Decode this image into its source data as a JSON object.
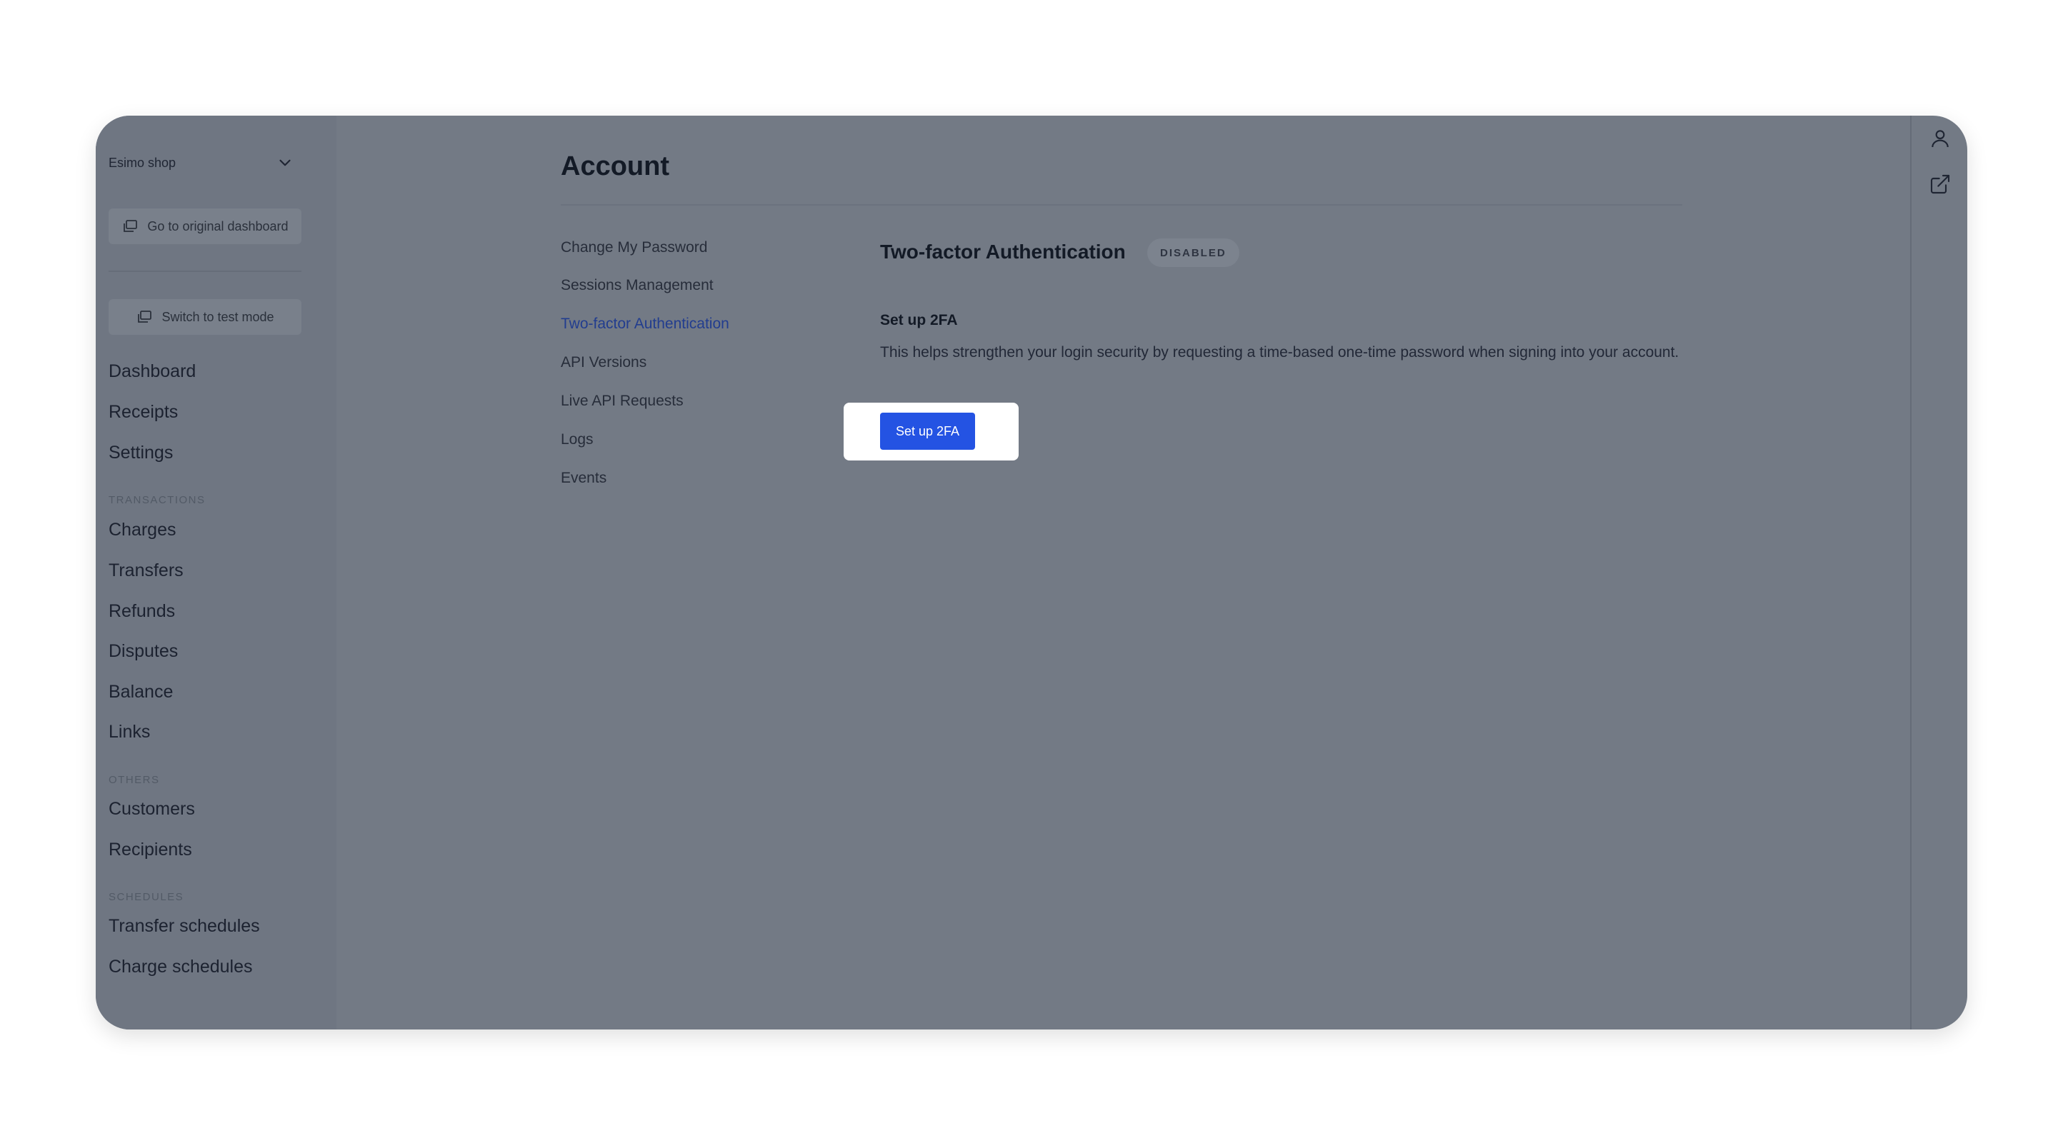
{
  "sidebar": {
    "shop_name": "Esimo shop",
    "go_original_label": "Go to original dashboard",
    "test_mode_label": "Switch to test mode",
    "main_items": [
      "Dashboard",
      "Receipts",
      "Settings"
    ],
    "transactions_label": "TRANSACTIONS",
    "transactions_items": [
      "Charges",
      "Transfers",
      "Refunds",
      "Disputes",
      "Balance",
      "Links"
    ],
    "others_label": "OTHERS",
    "others_items": [
      "Customers",
      "Recipients"
    ],
    "schedules_label": "SCHEDULES",
    "schedules_items": [
      "Transfer schedules",
      "Charge schedules"
    ]
  },
  "main": {
    "title": "Account",
    "subnav": [
      "Change My Password",
      "Sessions Management",
      "Two-factor Authentication",
      "API Versions",
      "Live API Requests",
      "Logs",
      "Events"
    ],
    "active_subnav": "Two-factor Authentication",
    "section_title": "Two-factor Authentication",
    "status_badge": "DISABLED",
    "setup_heading": "Set up 2FA",
    "setup_description": "This helps strengthen your login security by requesting a time-based one-time password when signing into your account.",
    "setup_button": "Set up 2FA"
  },
  "icons": {
    "shop_dropdown": "chevron-down-icon",
    "go_original": "window-stack-icon",
    "test_mode": "window-stack-icon",
    "profile": "user-icon",
    "external": "external-link-icon"
  },
  "colors": {
    "primary_button": "#2453e3",
    "active_link": "#223d8f",
    "overlay": "#737a85"
  }
}
